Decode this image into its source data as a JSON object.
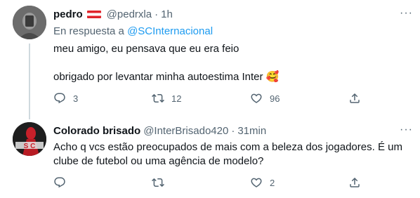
{
  "tweets": [
    {
      "name": "pedro",
      "handle": "@pedrxla",
      "dot": "·",
      "time": "1h",
      "reply_prefix": "En respuesta a",
      "reply_mention": "@SCInternacional",
      "text_line1": "meu amigo, eu pensava que eu era feio",
      "text_line2": "obrigado por levantar minha autoestima Inter",
      "emoji": "🥰",
      "more": "···",
      "replies": "3",
      "retweets": "12",
      "likes": "96"
    },
    {
      "name": "Colorado brisado",
      "handle": "@InterBrisado420",
      "dot": "·",
      "time": "31min",
      "text": "Acho q vcs estão preocupados de mais com a beleza dos jogadores. É um clube de futebol ou uma agência de modelo?",
      "more": "···",
      "replies": "",
      "retweets": "",
      "likes": "2"
    }
  ]
}
